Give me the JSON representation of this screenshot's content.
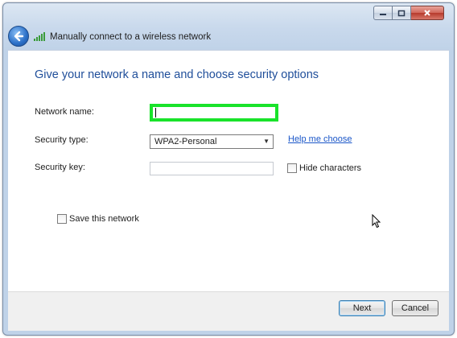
{
  "window": {
    "title": "Manually connect to a wireless network",
    "caption_buttons": [
      "minimize",
      "maximize",
      "close"
    ]
  },
  "header": {
    "back_icon": "back-arrow-icon",
    "network_icon": "wireless-signal-icon"
  },
  "main": {
    "heading": "Give your network a name and choose security options",
    "network_name_label": "Network name:",
    "network_name_value": "",
    "security_type_label": "Security type:",
    "security_type_value": "WPA2-Personal",
    "help_link": "Help me choose",
    "security_key_label": "Security key:",
    "security_key_value": "",
    "hide_characters_label": "Hide characters",
    "hide_characters_checked": false,
    "save_network_label": "Save this network",
    "save_network_checked": false
  },
  "footer": {
    "next_label": "Next",
    "cancel_label": "Cancel"
  },
  "colors": {
    "heading": "#1f4e9a",
    "link": "#1a56c8",
    "focus_highlight": "#19e32a"
  }
}
